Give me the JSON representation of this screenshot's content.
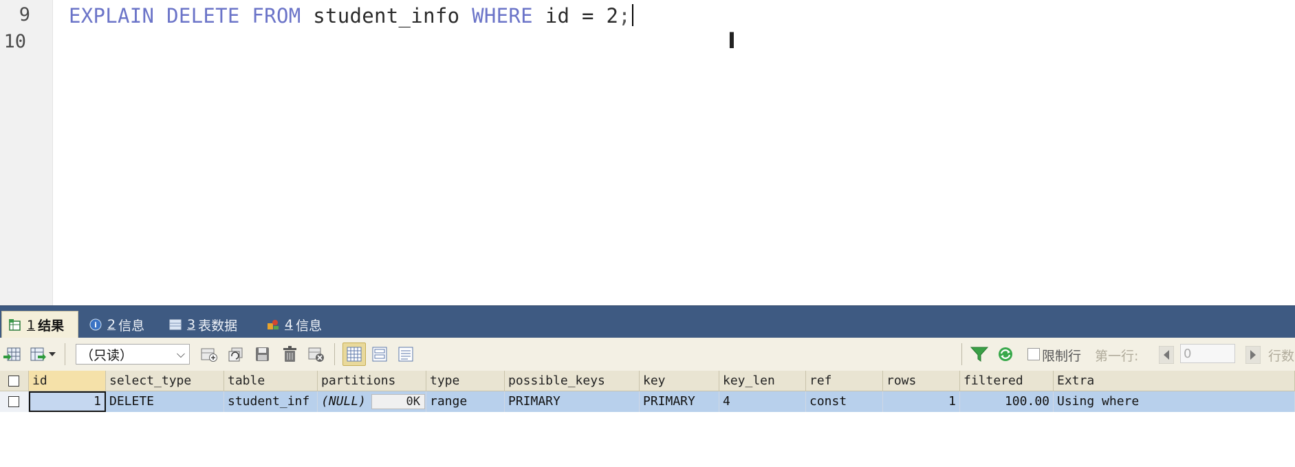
{
  "editor": {
    "lines": [
      {
        "number": "9"
      },
      {
        "number": "10"
      }
    ],
    "sql": {
      "kw1": "EXPLAIN",
      "kw2": "DELETE",
      "kw3": "FROM",
      "table": "student_info",
      "kw4": "WHERE",
      "condition": "id = 2",
      "terminator": ";"
    }
  },
  "result_tabs": [
    {
      "num": "1",
      "label": "结果",
      "active": true
    },
    {
      "num": "2",
      "label": "信息"
    },
    {
      "num": "3",
      "label": "表数据"
    },
    {
      "num": "4",
      "label": "信息"
    }
  ],
  "toolbar": {
    "mode_value": "（只读）",
    "limit_rows_label": "限制行",
    "first_row_label": "第一行:",
    "first_row_value": "0",
    "rows_label": "行数"
  },
  "grid": {
    "columns": [
      "id",
      "select_type",
      "table",
      "partitions",
      "type",
      "possible_keys",
      "key",
      "key_len",
      "ref",
      "rows",
      "filtered",
      "Extra"
    ],
    "rows": [
      {
        "id": "1",
        "select_type": "DELETE",
        "table": "student_inf",
        "partitions": "(NULL)",
        "partitions_size": "0K",
        "type": "range",
        "possible_keys": "PRIMARY",
        "key": "PRIMARY",
        "key_len": "4",
        "ref": "const",
        "rows": "1",
        "filtered": "100.00",
        "Extra": "Using where"
      }
    ]
  },
  "colors": {
    "keyword": "#6b74c8",
    "tab_bar": "#3e5a82",
    "row_selected": "#b8d0ec",
    "header_bg": "#e9e4d2"
  }
}
